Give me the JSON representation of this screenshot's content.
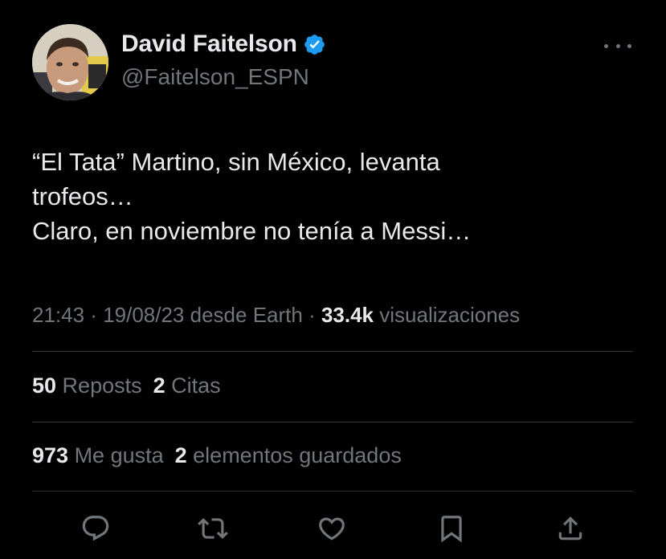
{
  "author": {
    "name": "David Faitelson",
    "handle": "@Faitelson_ESPN",
    "verified_color": "#1d9bf0"
  },
  "tweet": {
    "lines": [
      "“El Tata” Martino, sin México, levanta",
      "trofeos…",
      "Claro, en noviembre no tenía a Messi…"
    ]
  },
  "meta": {
    "time": "21:43",
    "sep1": " · ",
    "date": "19/08/23",
    "source": " desde Earth",
    "sep2": " · ",
    "views_count": "33.4k",
    "views_label": " visualizaciones"
  },
  "stats_row1": {
    "reposts_count": "50",
    "reposts_label": " Reposts",
    "quotes_count": "2",
    "quotes_label": " Citas"
  },
  "stats_row2": {
    "likes_count": "973",
    "likes_label": " Me gusta",
    "bookmarks_count": "2",
    "bookmarks_label": " elementos guardados"
  },
  "icons": {
    "more": "more-icon",
    "reply": "reply-icon",
    "retweet": "retweet-icon",
    "like": "heart-icon",
    "bookmark": "bookmark-icon",
    "share": "share-icon"
  },
  "colors": {
    "background": "#000000",
    "text": "#e7e9ea",
    "secondary": "#71767b",
    "divider": "#2f3336"
  }
}
